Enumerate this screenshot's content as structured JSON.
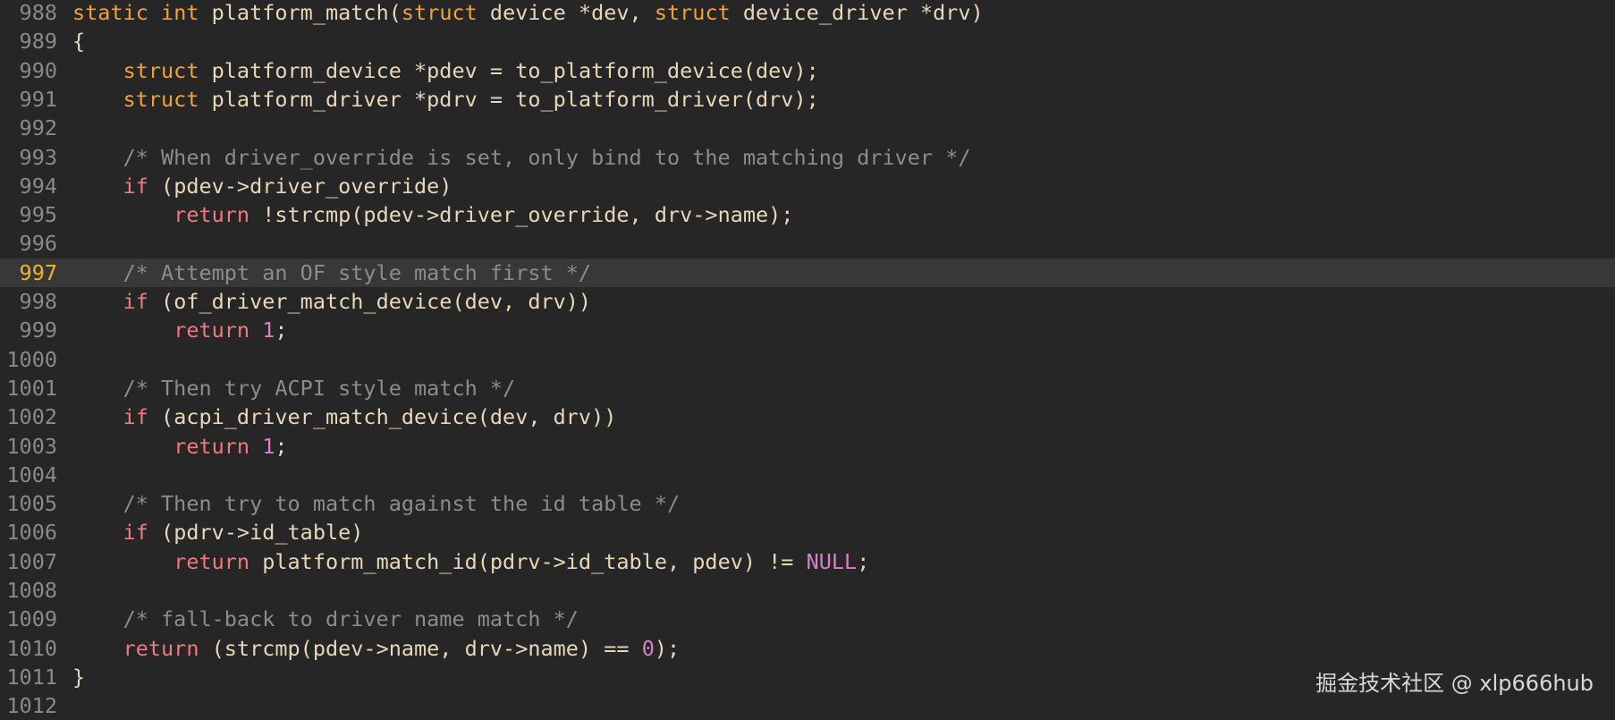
{
  "editor": {
    "current_line": "997",
    "lines": [
      {
        "n": "988",
        "tokens": [
          [
            "kw",
            "static "
          ],
          [
            "kw",
            "int "
          ],
          [
            "txt",
            "platform_match("
          ],
          [
            "kw",
            "struct "
          ],
          [
            "txt",
            "device *dev, "
          ],
          [
            "kw",
            "struct "
          ],
          [
            "txt",
            "device_driver *drv)"
          ]
        ]
      },
      {
        "n": "989",
        "tokens": [
          [
            "txt",
            "{"
          ]
        ]
      },
      {
        "n": "990",
        "tokens": [
          [
            "txt",
            "    "
          ],
          [
            "kw",
            "struct "
          ],
          [
            "txt",
            "platform_device *pdev = to_platform_device(dev);"
          ]
        ]
      },
      {
        "n": "991",
        "tokens": [
          [
            "txt",
            "    "
          ],
          [
            "kw",
            "struct "
          ],
          [
            "txt",
            "platform_driver *pdrv = to_platform_driver(drv);"
          ]
        ]
      },
      {
        "n": "992",
        "tokens": []
      },
      {
        "n": "993",
        "tokens": [
          [
            "txt",
            "    "
          ],
          [
            "cmt",
            "/* When driver_override is set, only bind to the matching driver */"
          ]
        ]
      },
      {
        "n": "994",
        "tokens": [
          [
            "txt",
            "    "
          ],
          [
            "ctl",
            "if "
          ],
          [
            "txt",
            "(pdev->driver_override)"
          ]
        ]
      },
      {
        "n": "995",
        "tokens": [
          [
            "txt",
            "        "
          ],
          [
            "ctl",
            "return "
          ],
          [
            "txt",
            "!strcmp(pdev->driver_override, drv->name);"
          ]
        ]
      },
      {
        "n": "996",
        "tokens": []
      },
      {
        "n": "997",
        "tokens": [
          [
            "txt",
            "    "
          ],
          [
            "cmt",
            "/* Attempt an OF style match first */"
          ]
        ]
      },
      {
        "n": "998",
        "tokens": [
          [
            "txt",
            "    "
          ],
          [
            "ctl",
            "if "
          ],
          [
            "txt",
            "(of_driver_match_device(dev, drv))"
          ]
        ]
      },
      {
        "n": "999",
        "tokens": [
          [
            "txt",
            "        "
          ],
          [
            "ctl",
            "return "
          ],
          [
            "num",
            "1"
          ],
          [
            "txt",
            ";"
          ]
        ]
      },
      {
        "n": "1000",
        "tokens": []
      },
      {
        "n": "1001",
        "tokens": [
          [
            "txt",
            "    "
          ],
          [
            "cmt",
            "/* Then try ACPI style match */"
          ]
        ]
      },
      {
        "n": "1002",
        "tokens": [
          [
            "txt",
            "    "
          ],
          [
            "ctl",
            "if "
          ],
          [
            "txt",
            "(acpi_driver_match_device(dev, drv))"
          ]
        ]
      },
      {
        "n": "1003",
        "tokens": [
          [
            "txt",
            "        "
          ],
          [
            "ctl",
            "return "
          ],
          [
            "num",
            "1"
          ],
          [
            "txt",
            ";"
          ]
        ]
      },
      {
        "n": "1004",
        "tokens": []
      },
      {
        "n": "1005",
        "tokens": [
          [
            "txt",
            "    "
          ],
          [
            "cmt",
            "/* Then try to match against the id table */"
          ]
        ]
      },
      {
        "n": "1006",
        "tokens": [
          [
            "txt",
            "    "
          ],
          [
            "ctl",
            "if "
          ],
          [
            "txt",
            "(pdrv->id_table)"
          ]
        ]
      },
      {
        "n": "1007",
        "tokens": [
          [
            "txt",
            "        "
          ],
          [
            "ctl",
            "return "
          ],
          [
            "txt",
            "platform_match_id(pdrv->id_table, pdev) != "
          ],
          [
            "num",
            "NULL"
          ],
          [
            "txt",
            ";"
          ]
        ]
      },
      {
        "n": "1008",
        "tokens": []
      },
      {
        "n": "1009",
        "tokens": [
          [
            "txt",
            "    "
          ],
          [
            "cmt",
            "/* fall-back to driver name match */"
          ]
        ]
      },
      {
        "n": "1010",
        "tokens": [
          [
            "txt",
            "    "
          ],
          [
            "ctl",
            "return "
          ],
          [
            "txt",
            "(strcmp(pdev->name, drv->name) == "
          ],
          [
            "num",
            "0"
          ],
          [
            "txt",
            ");"
          ]
        ]
      },
      {
        "n": "1011",
        "tokens": [
          [
            "txt",
            "}"
          ]
        ]
      },
      {
        "n": "1012",
        "tokens": []
      }
    ]
  },
  "watermark": {
    "text": "掘金技术社区 @ xlp666hub"
  },
  "colors": {
    "background": "#262626",
    "current_line_bg": "#383838",
    "gutter": "#8a8a8a",
    "gutter_current": "#f0b429",
    "keyword": "#f0a03c",
    "control": "#f07880",
    "number": "#d880c8",
    "comment": "#8c8c8c",
    "text": "#e8d7b8"
  }
}
